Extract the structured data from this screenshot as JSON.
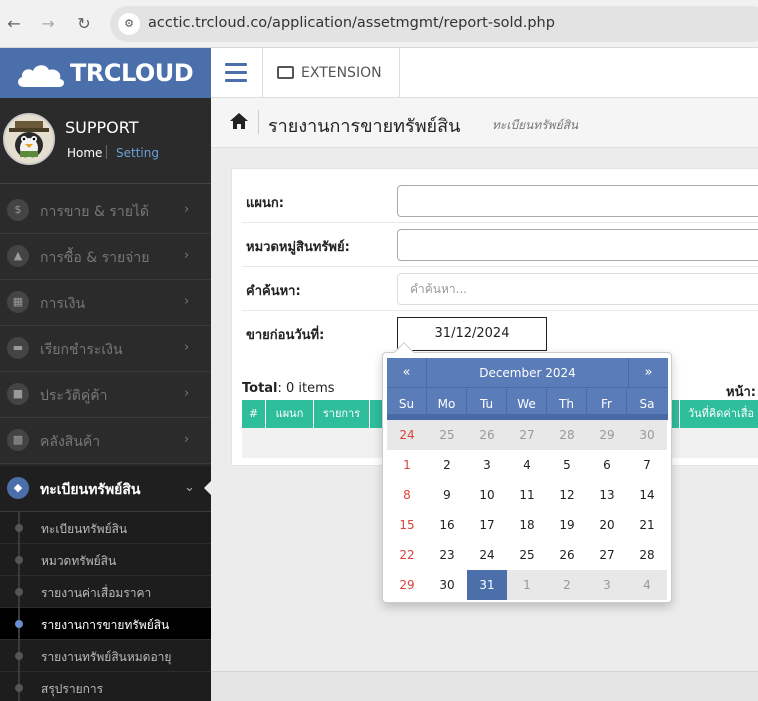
{
  "browser": {
    "url": "acctic.trcloud.co/application/assetmgmt/report-sold.php"
  },
  "brand": {
    "logo_text": "TRCLOUD"
  },
  "user": {
    "name": "SUPPORT",
    "home": "Home",
    "setting": "Setting"
  },
  "sidebar": {
    "items": [
      {
        "label": "การขาย & รายได้",
        "icon": "dollar-icon"
      },
      {
        "label": "การซื้อ & รายจ่าย",
        "icon": "cart-icon"
      },
      {
        "label": "การเงิน",
        "icon": "calendar-icon"
      },
      {
        "label": "เรียกชำระเงิน",
        "icon": "credit-card-icon"
      },
      {
        "label": "ประวัติคู่ค้า",
        "icon": "contact-icon"
      },
      {
        "label": "คลังสินค้า",
        "icon": "cubes-icon"
      },
      {
        "label": "ทะเบียนทรัพย์สิน",
        "icon": "diamond-icon"
      }
    ],
    "subitems": [
      {
        "label": "ทะเบียนทรัพย์สิน"
      },
      {
        "label": "หมวดทรัพย์สิน"
      },
      {
        "label": "รายงานค่าเสื่อมราคา"
      },
      {
        "label": "รายงานการขายทรัพย์สิน"
      },
      {
        "label": "รายงานทรัพย์สินหมดอายุ"
      },
      {
        "label": "สรุปรายการ"
      }
    ]
  },
  "topbar": {
    "extension": "EXTENSION"
  },
  "header": {
    "title": "รายงานการขายทรัพย์สิน",
    "subtitle": "ทะเบียนทรัพย์สิน"
  },
  "form": {
    "department_label": "แผนก:",
    "category_label": "หมวดหมู่สินทรัพย์:",
    "search_label": "คำค้นหา:",
    "search_placeholder": "คำค้นหา...",
    "date_label": "ขายก่อนวันที่:",
    "date_value": "31/12/2024"
  },
  "table": {
    "total_label": "Total",
    "total_value": ": 0 items",
    "page_label": "หน้า:",
    "columns": [
      "#",
      "แผนก",
      "รายการ",
      "",
      "วันที่คิดค่าเสื่อ"
    ]
  },
  "datepicker": {
    "prev": "«",
    "next": "»",
    "month_title": "December 2024",
    "weekdays": [
      "Su",
      "Mo",
      "Tu",
      "We",
      "Th",
      "Fr",
      "Sa"
    ],
    "days": [
      [
        "24",
        "25",
        "26",
        "27",
        "28",
        "29",
        "30"
      ],
      [
        "1",
        "2",
        "3",
        "4",
        "5",
        "6",
        "7"
      ],
      [
        "8",
        "9",
        "10",
        "11",
        "12",
        "13",
        "14"
      ],
      [
        "15",
        "16",
        "17",
        "18",
        "19",
        "20",
        "21"
      ],
      [
        "22",
        "23",
        "24",
        "25",
        "26",
        "27",
        "28"
      ],
      [
        "29",
        "30",
        "31",
        "1",
        "2",
        "3",
        "4"
      ]
    ],
    "selected": "31",
    "accent_color": "#4a6fab",
    "sunday_color": "#d9443a"
  }
}
